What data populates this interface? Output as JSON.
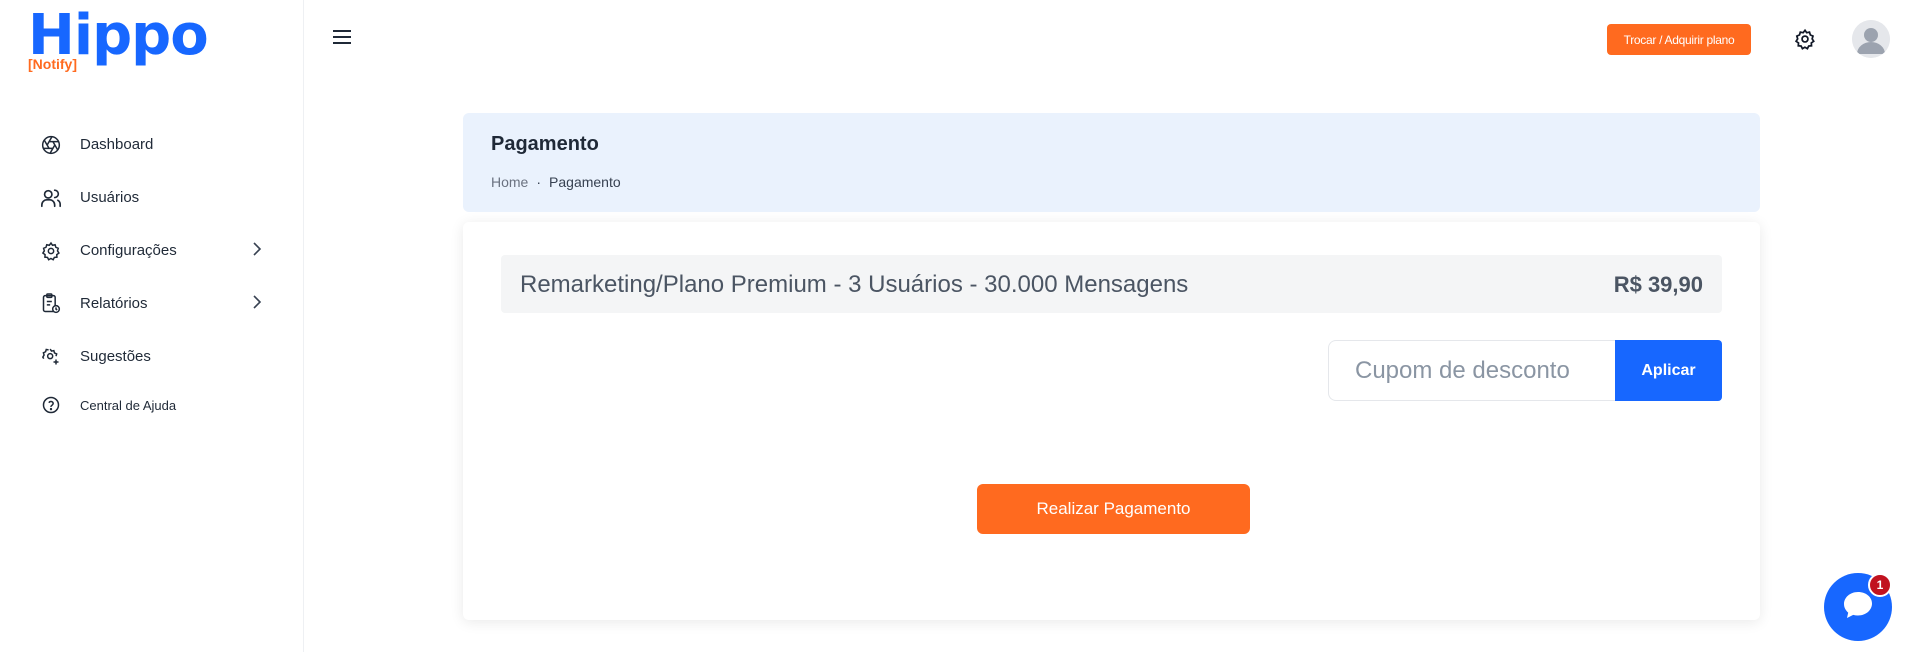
{
  "brand": {
    "name": "Hippo",
    "tagline": "[Notify]"
  },
  "sidebar": {
    "items": [
      {
        "label": "Dashboard",
        "icon": "dashboard-icon"
      },
      {
        "label": "Usuários",
        "icon": "users-icon"
      },
      {
        "label": "Configurações",
        "icon": "gear-icon",
        "expandable": true
      },
      {
        "label": "Relatórios",
        "icon": "report-icon",
        "expandable": true
      },
      {
        "label": "Sugestões",
        "icon": "suggestion-gear-icon"
      },
      {
        "label": "Central de Ajuda",
        "icon": "help-icon"
      }
    ]
  },
  "topbar": {
    "plan_button": "Trocar / Adquirir plano",
    "menu_icon": "hamburger-menu-icon",
    "settings_icon": "gear-icon",
    "avatar_icon": "user-avatar-icon"
  },
  "header": {
    "title": "Pagamento",
    "breadcrumb": {
      "home": "Home",
      "separator": "·",
      "current": "Pagamento"
    }
  },
  "payment": {
    "product_name": "Remarketing/Plano Premium - 3 Usuários - 30.000 Mensagens",
    "price": "R$ 39,90",
    "coupon_placeholder": "Cupom de desconto",
    "coupon_value": "",
    "apply_label": "Aplicar",
    "pay_label": "Realizar Pagamento"
  },
  "chat": {
    "badge_count": "1",
    "icon": "chat-bubble-icon"
  },
  "colors": {
    "primary": "#1767ff",
    "accent": "#ff6a1f",
    "header_bg": "#eaf2fd",
    "badge": "#c1121f"
  }
}
